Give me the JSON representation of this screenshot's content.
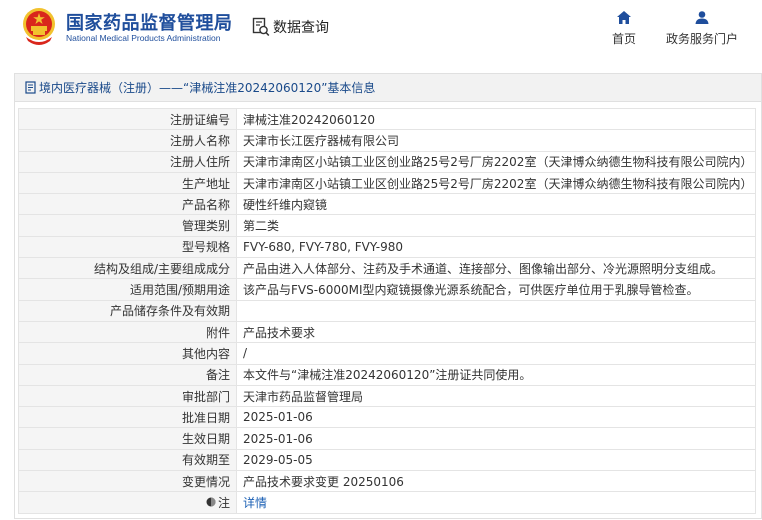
{
  "header": {
    "brand_cn": "国家药品监督管理局",
    "brand_en": "National Medical Products Administration",
    "query_label": "数据查询",
    "nav": [
      {
        "label": "首页",
        "icon": "home-icon"
      },
      {
        "label": "政务服务门户",
        "icon": "user-icon"
      }
    ]
  },
  "breadcrumb": {
    "text": "境内医疗器械（注册）——“津械注准20242060120”基本信息"
  },
  "details": {
    "rows": [
      {
        "key": "注册证编号",
        "value": "津械注准20242060120"
      },
      {
        "key": "注册人名称",
        "value": "天津市长江医疗器械有限公司"
      },
      {
        "key": "注册人住所",
        "value": "天津市津南区小站镇工业区创业路25号2号厂房2202室（天津博众纳德生物科技有限公司院内）"
      },
      {
        "key": "生产地址",
        "value": "天津市津南区小站镇工业区创业路25号2号厂房2202室（天津博众纳德生物科技有限公司院内）"
      },
      {
        "key": "产品名称",
        "value": "硬性纤维内窥镜"
      },
      {
        "key": "管理类别",
        "value": "第二类"
      },
      {
        "key": "型号规格",
        "value": "FVY-680, FVY-780, FVY-980"
      },
      {
        "key": "结构及组成/主要组成成分",
        "value": "产品由进入人体部分、注药及手术通道、连接部分、图像输出部分、冷光源照明分支组成。"
      },
      {
        "key": "适用范围/预期用途",
        "value": "该产品与FVS-6000MI型内窥镜摄像光源系统配合，可供医疗单位用于乳腺导管检查。"
      },
      {
        "key": "产品储存条件及有效期",
        "value": ""
      },
      {
        "key": "附件",
        "value": "产品技术要求"
      },
      {
        "key": "其他内容",
        "value": "/"
      },
      {
        "key": "备注",
        "value": "本文件与“津械注准20242060120”注册证共同使用。"
      },
      {
        "key": "审批部门",
        "value": "天津市药品监督管理局"
      },
      {
        "key": "批准日期",
        "value": "2025-01-06"
      },
      {
        "key": "生效日期",
        "value": "2025-01-06"
      },
      {
        "key": "有效期至",
        "value": "2029-05-05"
      },
      {
        "key": "变更情况",
        "value": "产品技术要求变更 20250106"
      }
    ],
    "note_key": "注",
    "note_link": "详情"
  },
  "colors": {
    "brand_blue": "#1f4e9c",
    "link_blue": "#1a5fb4",
    "emblem_red": "#d9261c",
    "emblem_gold": "#f2c22e"
  }
}
